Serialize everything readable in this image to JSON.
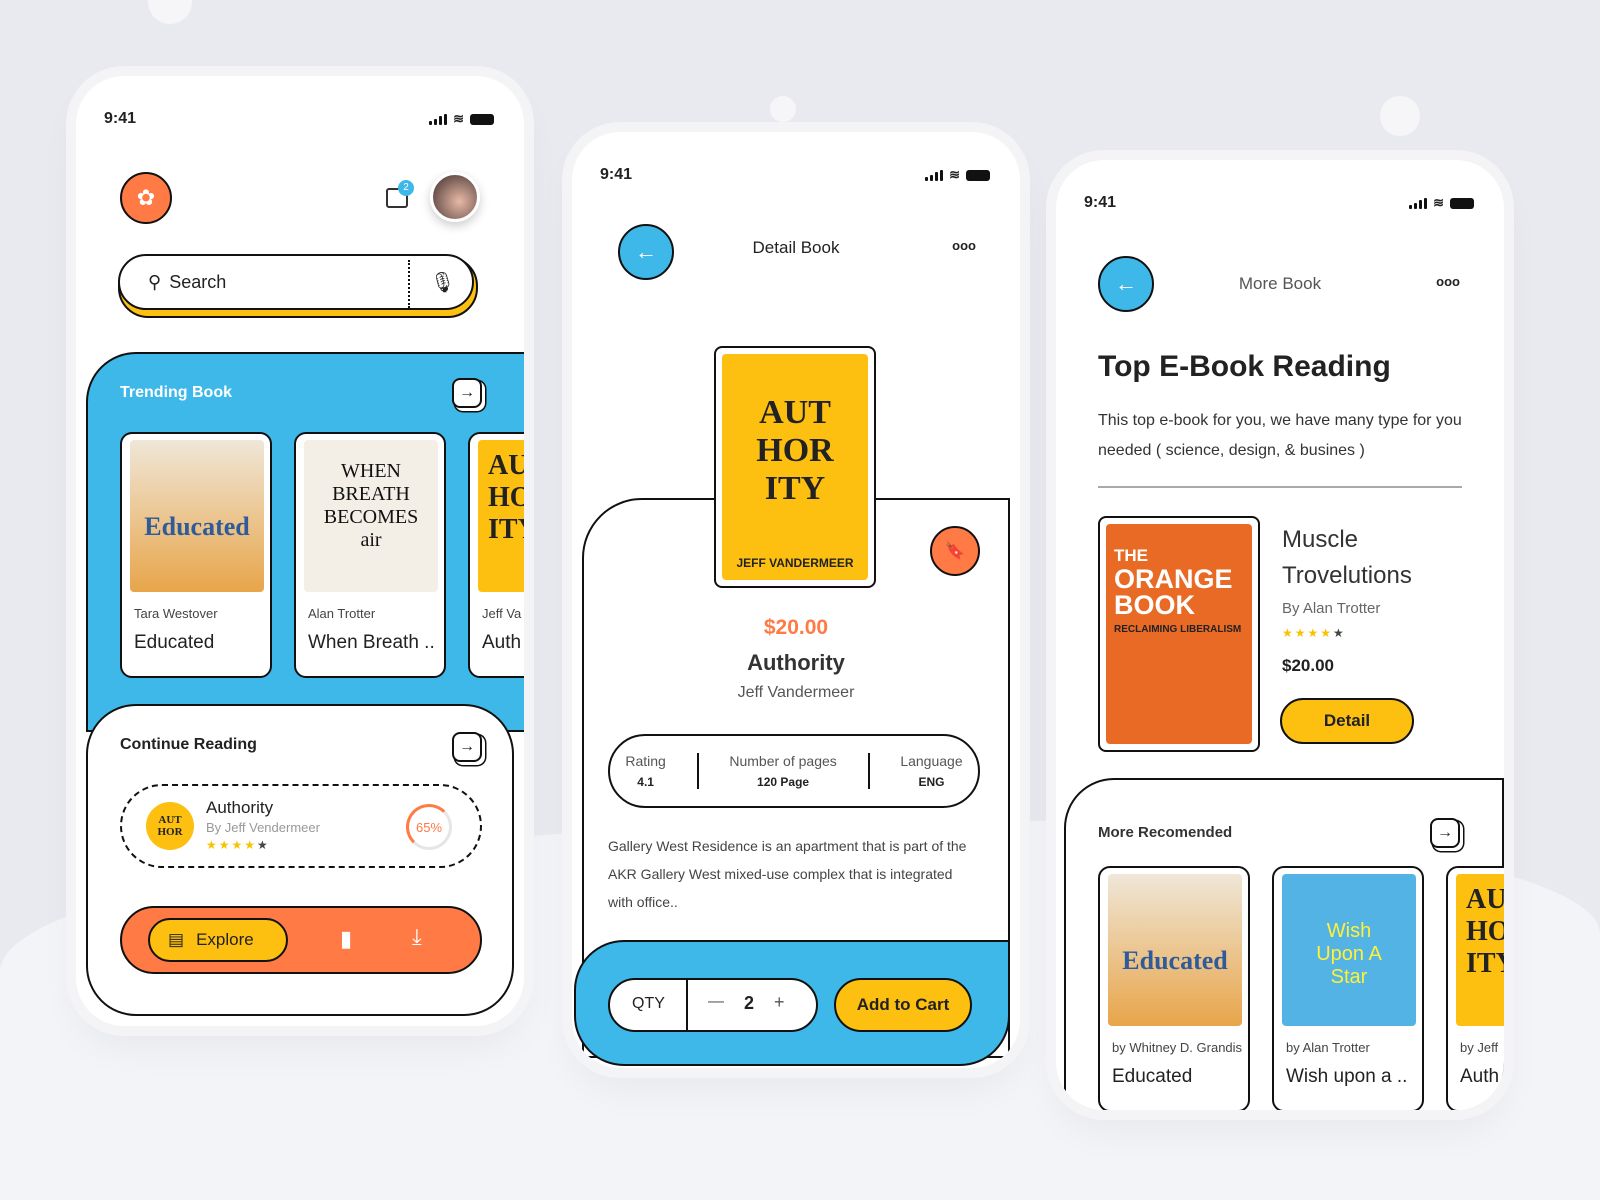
{
  "phone1": {
    "time": "9:41",
    "notif_count": "2",
    "search_placeholder": "Search",
    "trending": {
      "title": "Trending Book",
      "books": [
        {
          "author": "Tara Westover",
          "title": "Educated",
          "cover": "Educated"
        },
        {
          "author": "Alan Trotter",
          "title": "When Breath ..",
          "cover": "WHEN BREATH BECOMES air"
        },
        {
          "author": "Jeff Va",
          "title": "Auth",
          "cover": "AUT HOR ITY"
        }
      ]
    },
    "continue": {
      "title": "Continue Reading",
      "book": "Authority",
      "author": "By Jeff Vendermeer",
      "progress_label": "65%",
      "progress": 0.65,
      "rating": 4
    },
    "nav": {
      "explore": "Explore"
    }
  },
  "phone2": {
    "time": "9:41",
    "title": "Detail Book",
    "more": "ooo",
    "cover_title": "AUT HOR ITY",
    "cover_author": "JEFF VANDERMEER",
    "price": "$20.00",
    "book": "Authority",
    "author": "Jeff Vandermeer",
    "stats": [
      {
        "label": "Rating",
        "value": "4.1"
      },
      {
        "label": "Number of pages",
        "value": "120 Page"
      },
      {
        "label": "Language",
        "value": "ENG"
      }
    ],
    "description": "Gallery West Residence is an apartment that is part of the AKR Gallery West mixed-use complex that is integrated with office..",
    "qty_label": "QTY",
    "qty": "2",
    "minus": "—",
    "plus": "+",
    "add_to_cart": "Add to Cart"
  },
  "phone3": {
    "time": "9:41",
    "title": "More Book",
    "more": "ooo",
    "heading": "Top E-Book Reading",
    "subtitle": "This top e-book for you, we have many type for you needed ( science, design, & busines )",
    "featured": {
      "cover_the": "THE",
      "cover_title": "ORANGE BOOK",
      "cover_sub": "RECLAIMING LIBERALISM",
      "title": "Muscle Trovelutions",
      "author": "By Alan Trotter",
      "price": "$20.00",
      "rating": 4,
      "detail": "Detail"
    },
    "recommended": {
      "title": "More Recomended",
      "books": [
        {
          "author": "by Whitney D. Grandis",
          "title": "Educated",
          "cover": "Educated"
        },
        {
          "author": "by Alan Trotter",
          "title": "Wish upon a ..",
          "cover": "Wish Upon A Star"
        },
        {
          "author": "by Jeff",
          "title": "Auth",
          "cover": "AUT HOR ITY"
        }
      ]
    }
  },
  "colors": {
    "blue": "#3db8e9",
    "orange": "#ff7a45",
    "yellow": "#fdc010"
  }
}
